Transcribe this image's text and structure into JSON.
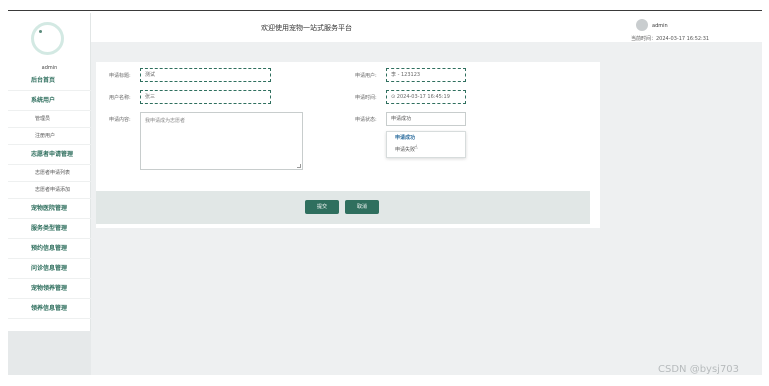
{
  "sidebar": {
    "username": "admin",
    "items": [
      {
        "label": "后台首页",
        "type": "top"
      },
      {
        "label": "系统用户",
        "type": "top"
      },
      {
        "label": "管理员",
        "type": "sub"
      },
      {
        "label": "注册用户",
        "type": "sub"
      },
      {
        "label": "志愿者申请管理",
        "type": "top"
      },
      {
        "label": "志愿者申请列表",
        "type": "sub"
      },
      {
        "label": "志愿者申请添加",
        "type": "sub"
      },
      {
        "label": "宠物医院管理",
        "type": "top"
      },
      {
        "label": "服务类型管理",
        "type": "top"
      },
      {
        "label": "预约信息管理",
        "type": "top"
      },
      {
        "label": "问诊信息管理",
        "type": "top"
      },
      {
        "label": "宠物领养管理",
        "type": "top"
      },
      {
        "label": "领养信息管理",
        "type": "top"
      }
    ]
  },
  "header": {
    "title": "欢迎使用宠物一站式服务平台",
    "user": "admin",
    "time_label": "当前时间：2024-03-17 16:52:31"
  },
  "form": {
    "title_label": "申请标题:",
    "title_value": "测试",
    "user_label": "申请用户:",
    "user_value": "李 - 123123",
    "name_label": "用户名称:",
    "name_value": "张三",
    "time_label": "申请时间:",
    "time_value": "⊙ 2024-03-17 16:45:19",
    "content_label": "申请内容:",
    "content_value": "我申请成为志愿者",
    "status_label": "申请状态:",
    "status_value": "申请成功",
    "status_options": [
      "申请成功",
      "申请失败"
    ],
    "cursor_icon": "pointer-hand-icon"
  },
  "buttons": {
    "save": "提交",
    "cancel": "取消"
  },
  "watermark": "CSDN @bysj703"
}
